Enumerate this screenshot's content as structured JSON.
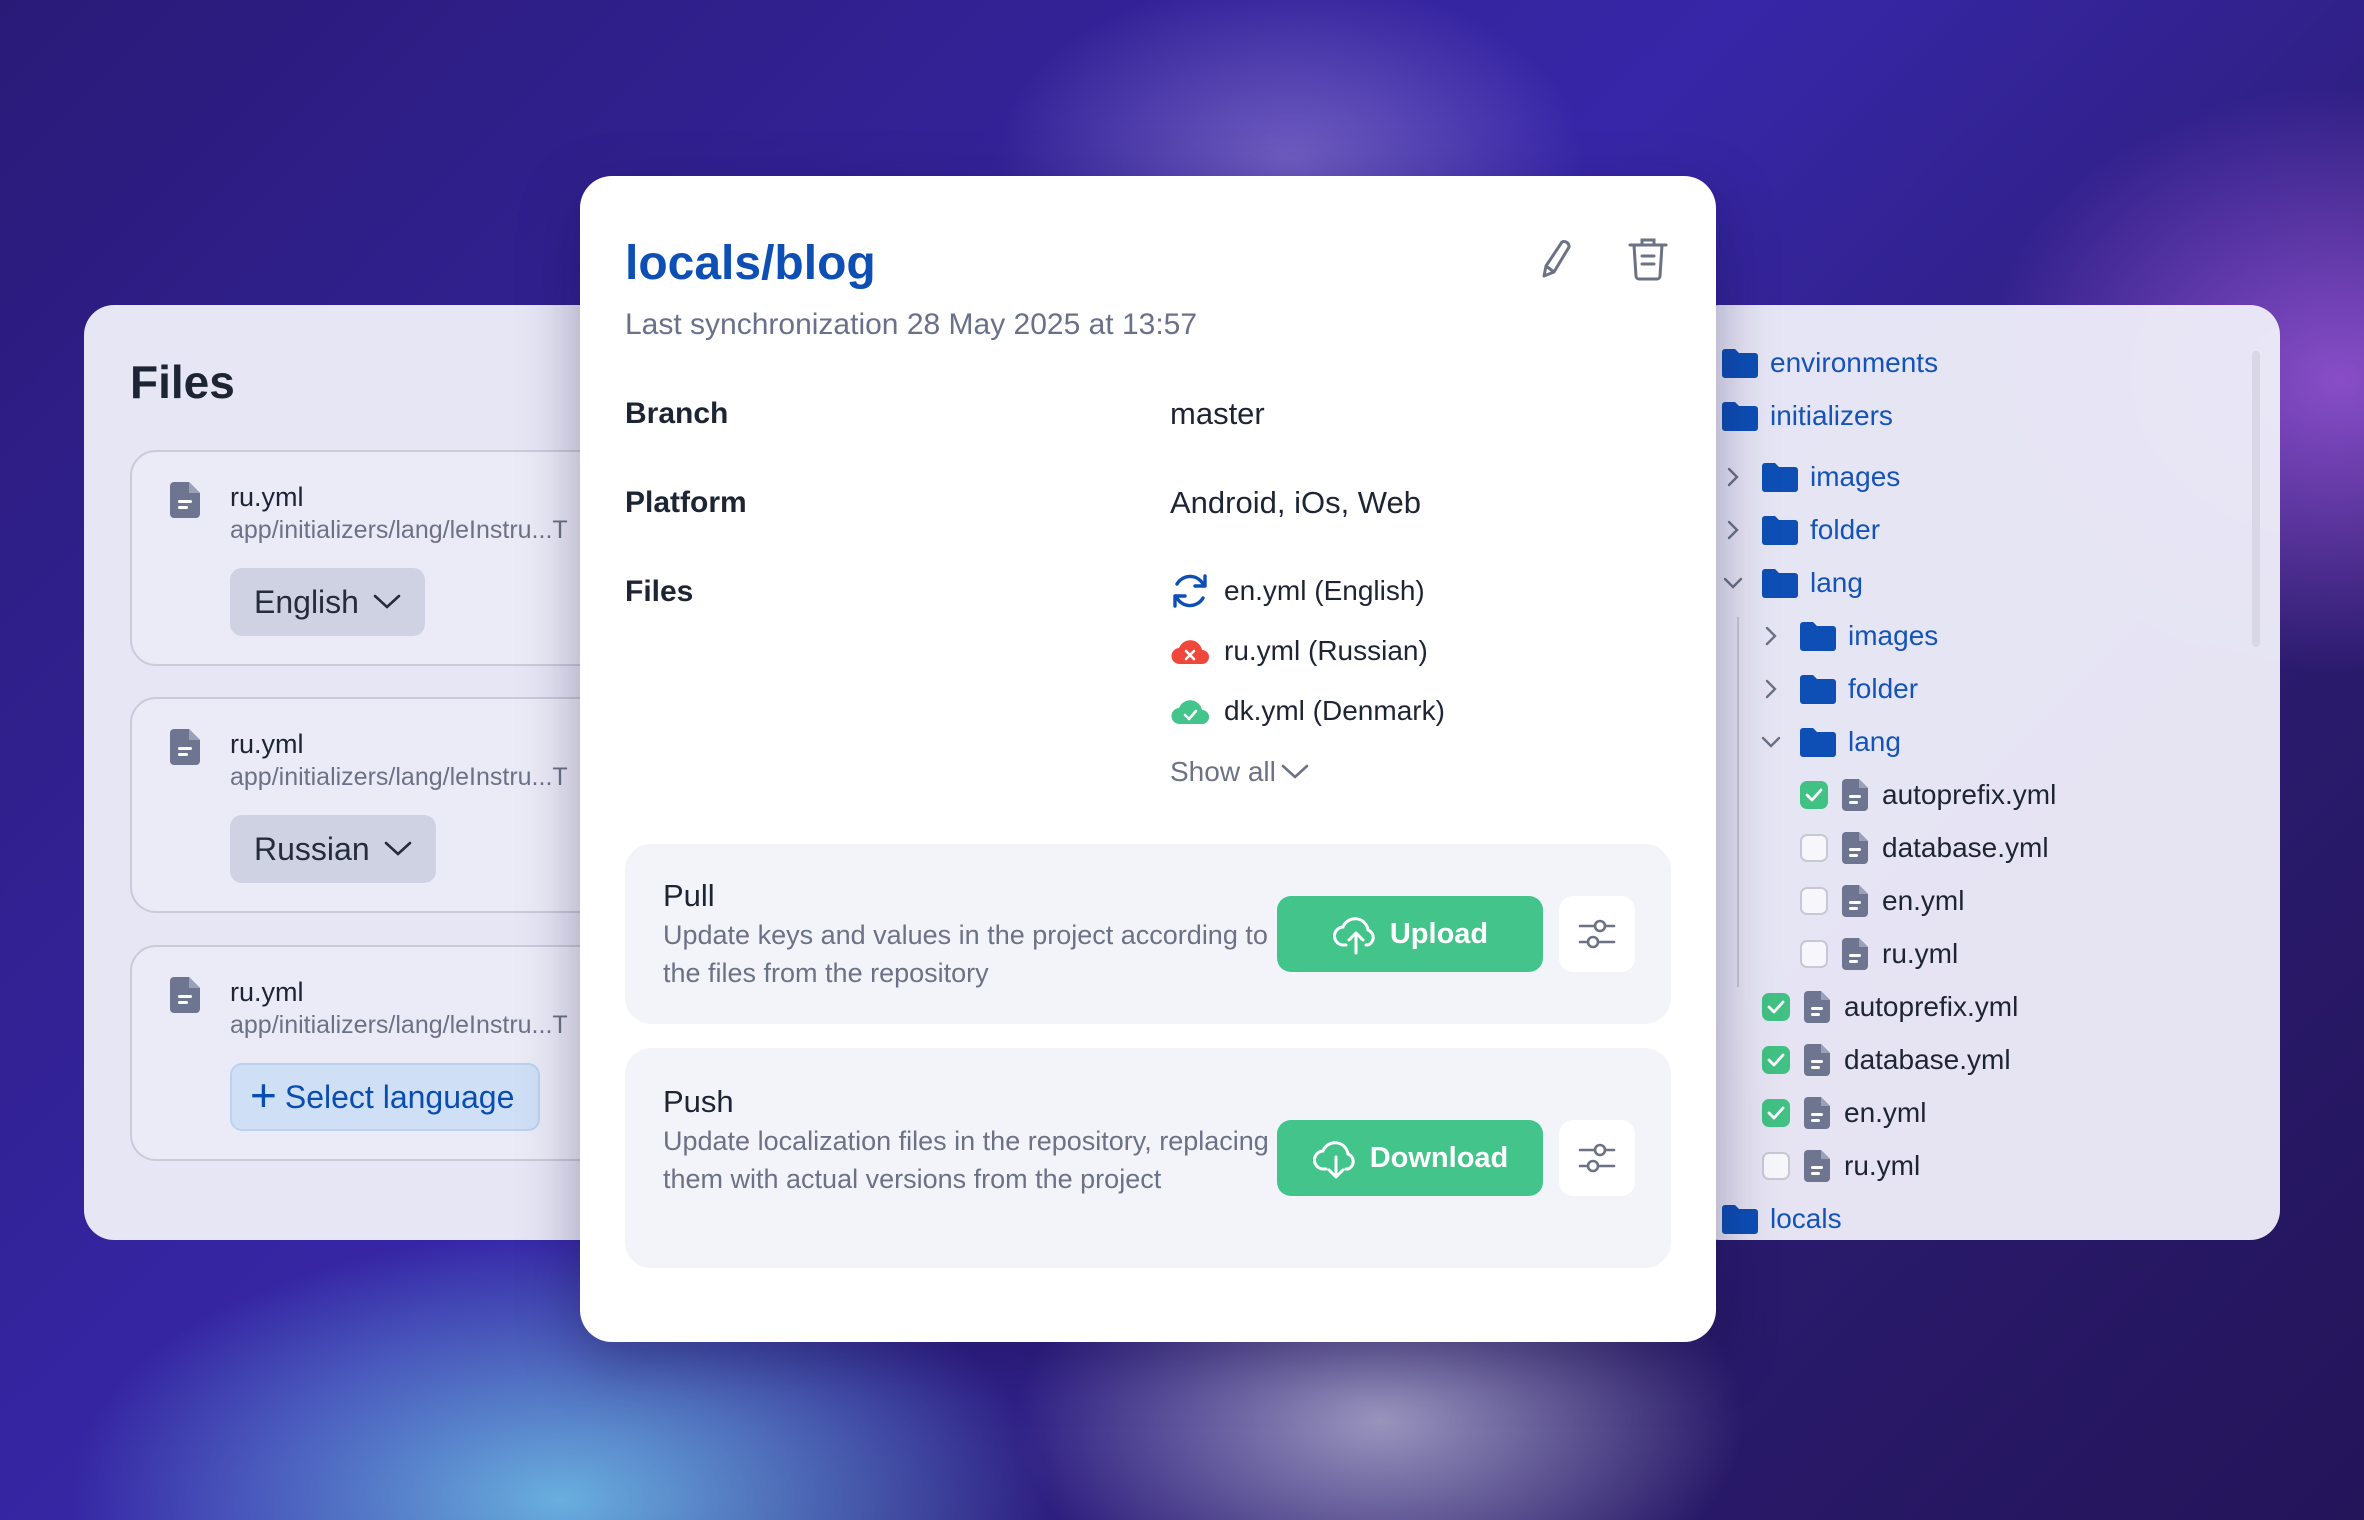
{
  "left_panel": {
    "title": "Files",
    "cards": [
      {
        "name": "ru.yml",
        "path": "app/initializers/lang/leInstru...T",
        "language": "English",
        "action": "dropdown"
      },
      {
        "name": "ru.yml",
        "path": "app/initializers/lang/leInstru...T",
        "language": "Russian",
        "action": "dropdown"
      },
      {
        "name": "ru.yml",
        "path": "app/initializers/lang/leInstru...T",
        "select_label": "Select language",
        "action": "select"
      }
    ]
  },
  "main": {
    "title": "locals/blog",
    "subtitle": "Last synchronization 28 May 2025 at 13:57",
    "rows": {
      "branch_label": "Branch",
      "branch_value": "master",
      "platform_label": "Platform",
      "platform_value": "Android, iOs, Web",
      "files_label": "Files"
    },
    "files": [
      {
        "label": "en.yml (English)",
        "status": "syncing"
      },
      {
        "label": "ru.yml (Russian)",
        "status": "error"
      },
      {
        "label": "dk.yml (Denmark)",
        "status": "success"
      }
    ],
    "show_all": "Show all",
    "pull": {
      "title": "Pull",
      "description": "Update keys and values in the project according to the files from the repository",
      "button": "Upload"
    },
    "push": {
      "title": "Push",
      "description": "Update localization files in the repository, replacing them with actual versions from the project",
      "button": "Download"
    }
  },
  "tree": {
    "items": [
      {
        "label": "environments",
        "type": "folder"
      },
      {
        "label": "initializers",
        "type": "folder"
      },
      {
        "label": "images",
        "type": "folder",
        "expanded": false
      },
      {
        "label": "folder",
        "type": "folder",
        "expanded": false
      },
      {
        "label": "lang",
        "type": "folder",
        "expanded": true
      },
      {
        "label": "images",
        "type": "folder",
        "expanded": false
      },
      {
        "label": "folder",
        "type": "folder",
        "expanded": false
      },
      {
        "label": "lang",
        "type": "folder",
        "expanded": true
      },
      {
        "label": "autoprefix.yml",
        "type": "file",
        "checked": true
      },
      {
        "label": "database.yml",
        "type": "file",
        "checked": false
      },
      {
        "label": "en.yml",
        "type": "file",
        "checked": false
      },
      {
        "label": "ru.yml",
        "type": "file",
        "checked": false
      },
      {
        "label": "autoprefix.yml",
        "type": "file",
        "checked": true
      },
      {
        "label": "database.yml",
        "type": "file",
        "checked": true
      },
      {
        "label": "en.yml",
        "type": "file",
        "checked": true
      },
      {
        "label": "ru.yml",
        "type": "file",
        "checked": false
      },
      {
        "label": "locals",
        "type": "folder"
      }
    ]
  },
  "colors": {
    "brand_blue": "#0d4fb5",
    "success_green": "#42c48a",
    "error_red": "#f0473c",
    "muted_text": "#6b7286"
  }
}
